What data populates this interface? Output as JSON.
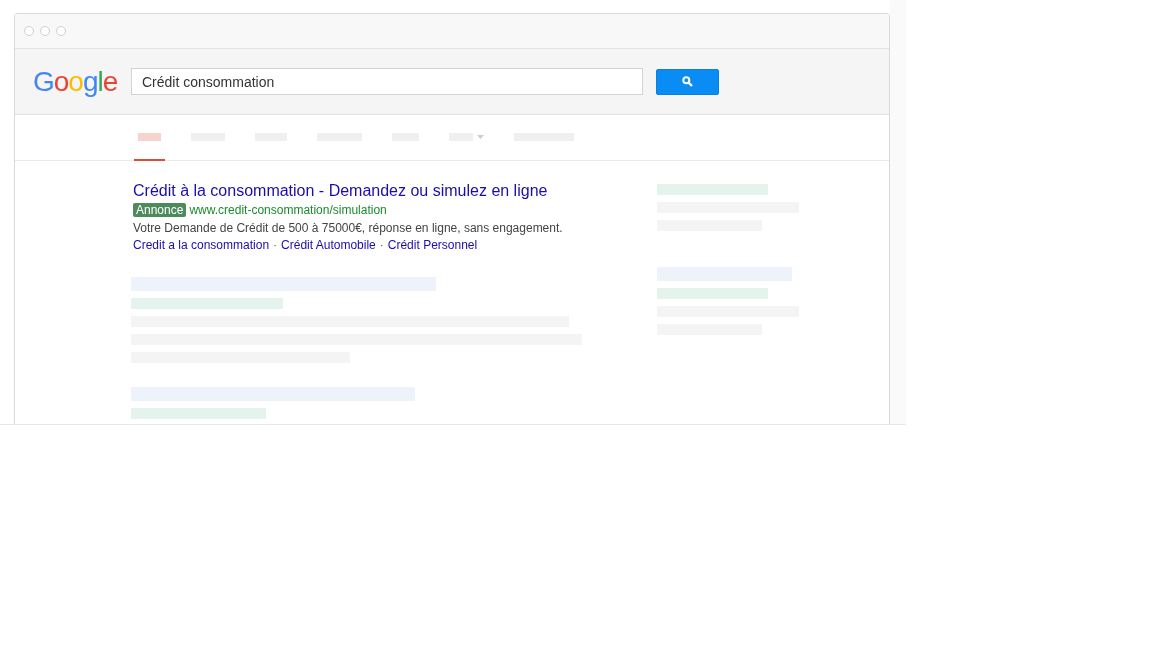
{
  "logo": "Google",
  "search": {
    "value": "Crédit consommation"
  },
  "tabs": [
    {
      "kind": "plain",
      "selected": true
    },
    {
      "kind": "plain",
      "selected": false
    },
    {
      "kind": "plain",
      "selected": false
    },
    {
      "kind": "plain",
      "selected": false
    },
    {
      "kind": "plain",
      "selected": false
    },
    {
      "kind": "dropdown",
      "selected": false
    },
    {
      "kind": "plain",
      "selected": false
    }
  ],
  "ad": {
    "title": "Crédit à la consommation - Demandez ou simulez en ligne",
    "badge": "Annonce",
    "url": "www.credit-consommation/simulation",
    "description": "Votre Demande de Crédit de 500 à 75000€, réponse en ligne, sans engagement.",
    "separator": "·",
    "sitelinks": [
      "Credit a la consommation",
      "Crédit Automobile",
      "Crédit Personnel"
    ]
  }
}
